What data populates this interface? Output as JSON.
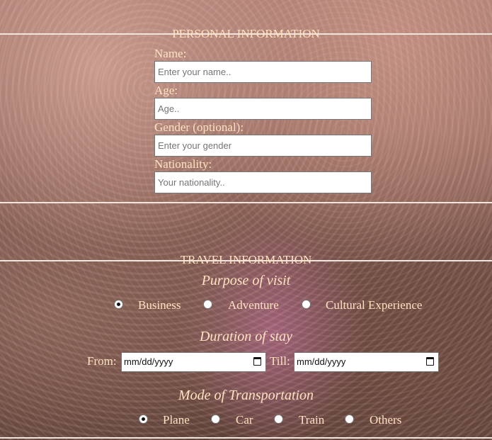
{
  "personal": {
    "legend": "PERSONAL INFORMATION",
    "name_label": "Name:",
    "name_placeholder": "Enter your name..",
    "age_label": "Age:",
    "age_placeholder": "Age..",
    "gender_label": "Gender (optional):",
    "gender_placeholder": "Enter your gender",
    "nationality_label": "Nationality:",
    "nationality_placeholder": "Your nationality.."
  },
  "travel": {
    "legend": "TRAVEL INFORMATION",
    "purpose_heading": "Purpose of visit",
    "purpose_options": [
      "Business",
      "Adventure",
      "Cultural Experience"
    ],
    "purpose_selected": "Business",
    "duration_heading": "Duration of stay",
    "from_label": "From:",
    "till_label": "Till:",
    "date_format": "mm/dd/yyyy",
    "transport_heading": "Mode of Transportation",
    "transport_options": [
      "Plane",
      "Car",
      "Train",
      "Others"
    ],
    "transport_selected": "Plane"
  }
}
